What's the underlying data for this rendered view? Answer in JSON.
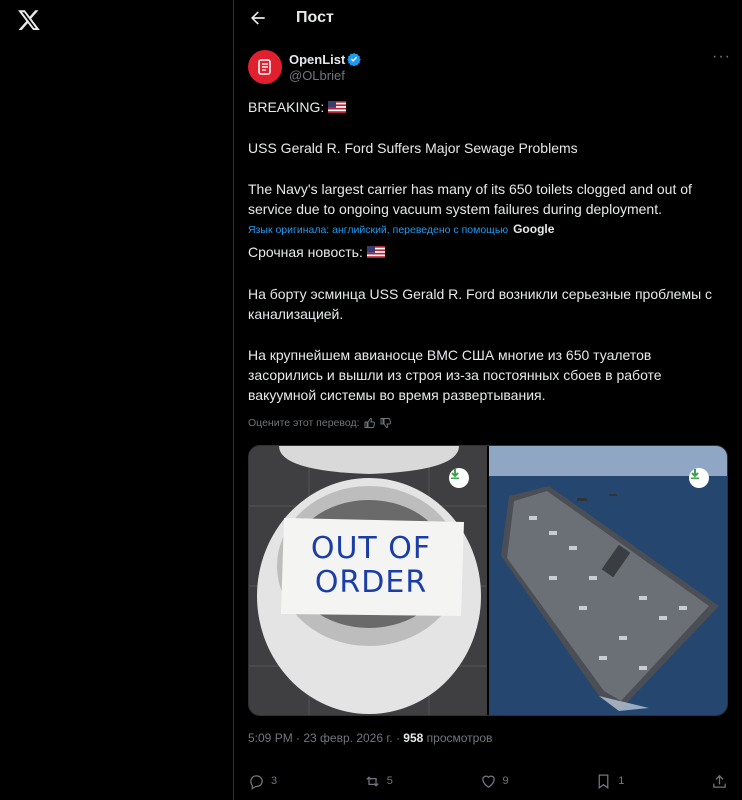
{
  "header": {
    "title": "Пост"
  },
  "author": {
    "name": "OpenList",
    "handle": "@OLbrief"
  },
  "post": {
    "line1": "BREAKING:",
    "line2": "USS Gerald R. Ford Suffers Major Sewage Problems",
    "line3": "The Navy's largest carrier has many of its 650 toilets clogged and out of service due to ongoing vacuum system failures during deployment.",
    "translation_note": "Язык оригинала: английский, переведено с помощью",
    "translation_provider": "Google",
    "tr_line1": "Срочная новость:",
    "tr_line2": "На борту эсминца USS Gerald R. Ford возникли серьезные проблемы с канализацией.",
    "tr_line3": "На крупнейшем авианосце ВМС США многие из 650 туалетов засорились и вышли из строя из-за постоянных сбоев в работе вакуумной системы во время развертывания.",
    "rate_label": "Оцените этот перевод:"
  },
  "media": {
    "sign_text": "OUT OF ORDER"
  },
  "meta": {
    "time": "5:09 PM",
    "date": "23 февр. 2026 г.",
    "views_count": "958",
    "views_label": "просмотров"
  },
  "actions": {
    "replies": "3",
    "reposts": "5",
    "likes": "9",
    "bookmarks": "1"
  },
  "colors": {
    "accent": "#1d9bf0",
    "background": "#000000",
    "text": "#e7e9ea",
    "muted": "#71767b",
    "avatar": "#e0202e"
  }
}
